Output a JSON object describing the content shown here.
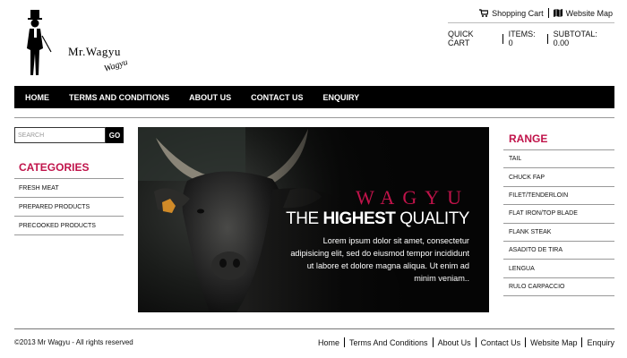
{
  "logo": {
    "text": "Mr.Wagyu",
    "signature": "Wagyu"
  },
  "top_links": {
    "cart": "Shopping Cart",
    "sitemap": "Website Map"
  },
  "cart_bar": {
    "quick_cart": "QUICK CART",
    "items": "ITEMS: 0",
    "subtotal": "SUBTOTAL: 0.00"
  },
  "nav": [
    "HOME",
    "TERMS AND CONDITIONS",
    "ABOUT US",
    "CONTACT US",
    "ENQUIRY"
  ],
  "search": {
    "placeholder": "SEARCH",
    "button": "GO"
  },
  "categories": {
    "title": "CATEGORIES",
    "items": [
      "FRESH MEAT",
      "PREPARED PRODUCTS",
      "PRECOOKED PRODUCTS"
    ]
  },
  "banner": {
    "brand": "WAGYU",
    "headline_pre": "THE",
    "headline_bold": "HIGHEST",
    "headline_post": "QUALITY",
    "text": "Lorem ipsum dolor sit amet, consectetur adipisicing elit, sed do eiusmod tempor incididunt ut labore et dolore magna aliqua. Ut enim ad minim veniam.."
  },
  "range": {
    "title": "RANGE",
    "items": [
      "TAIL",
      "CHUCK FAP",
      "FILET/TENDERLOIN",
      "FLAT IRON/TOP BLADE",
      "FLANK STEAK",
      "ASADITO DE TIRA",
      "LENGUA",
      "RULO CARPACCIO"
    ]
  },
  "footer": {
    "copyright": "©2013 Mr Wagyu - All rights reserved",
    "links": [
      "Home",
      "Terms And Conditions",
      "About Us",
      "Contact Us",
      "Website Map",
      "Enquiry"
    ]
  },
  "colors": {
    "accent": "#c0134a",
    "nav_bg": "#000000"
  }
}
